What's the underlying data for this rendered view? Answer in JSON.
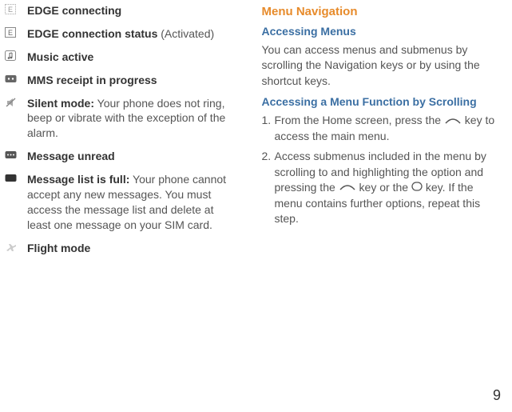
{
  "left": {
    "items": [
      {
        "icon": "edge-connecting-icon",
        "bold": "EDGE connecting",
        "rest": ""
      },
      {
        "icon": "edge-active-icon",
        "bold": "EDGE connection status",
        "rest": " (Activated)"
      },
      {
        "icon": "music-icon",
        "bold": "Music active",
        "rest": ""
      },
      {
        "icon": "mms-icon",
        "bold": "MMS receipt in progress",
        "rest": ""
      },
      {
        "icon": "silent-icon",
        "bold": "Silent mode:",
        "rest": " Your phone does not ring, beep or vibrate with the exception of the alarm."
      },
      {
        "icon": "message-unread-icon",
        "bold": "Message unread",
        "rest": ""
      },
      {
        "icon": "message-full-icon",
        "bold": "Message list is full:",
        "rest": " Your phone cannot accept any new messages. You must access the message list and delete at least one message on your SIM card."
      },
      {
        "icon": "flight-icon",
        "bold": "Flight mode",
        "rest": ""
      }
    ]
  },
  "right": {
    "h1": "Menu Navigation",
    "h2a": "Accessing Menus",
    "para1": "You can access menus and submenus by scrolling the Navigation keys or by using the shortcut keys.",
    "h2b": "Accessing a Menu Function by Scrolling",
    "step1_pre": "From the Home screen, press the ",
    "step1_post": " key to access the main menu.",
    "step2_pre": "Access submenus included in the menu by scrolling to and highlighting the option and pressing the ",
    "step2_mid": " key or the ",
    "step2_post": " key. If the menu contains further options, repeat this step."
  },
  "page_number": "9"
}
